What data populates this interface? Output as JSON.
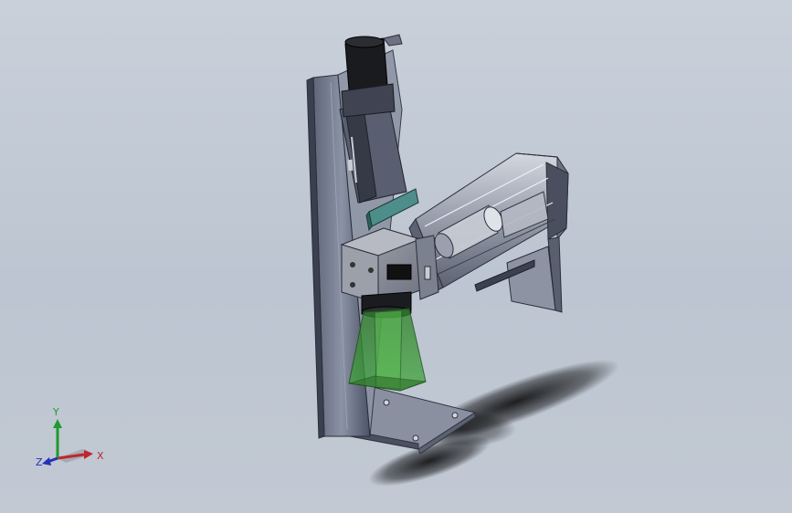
{
  "viewport": {
    "background_top": "#c9d0da",
    "background_bottom": "#c2c9d3"
  },
  "triad": {
    "x_label": "X",
    "y_label": "Y",
    "z_label": "Z",
    "x_color": "#c0262b",
    "y_color": "#1f9a2e",
    "z_color": "#2432b8"
  },
  "model": {
    "icon": "laser-marking-machine-3d-model"
  }
}
